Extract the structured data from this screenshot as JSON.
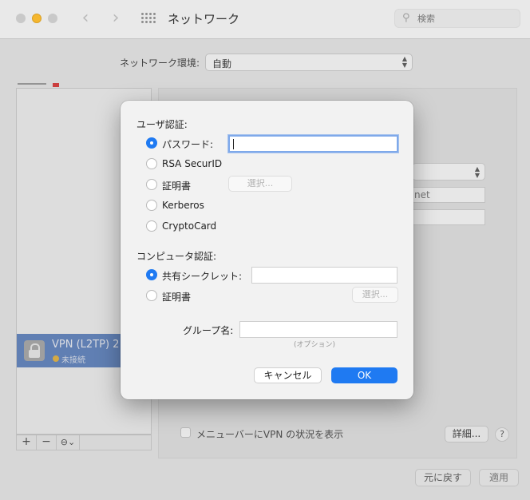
{
  "window": {
    "title": "ネットワーク",
    "search_placeholder": "検索",
    "icons": {
      "back": "chevron-left-icon",
      "forward": "chevron-right-icon",
      "grid": "grid-icon",
      "search": "search-icon"
    }
  },
  "location": {
    "label": "ネットワーク環境:",
    "value": "自動"
  },
  "sidebar": {
    "selected_service": {
      "name": "VPN (L2TP) 2",
      "status": "未接続"
    },
    "toolbar": {
      "add": "+",
      "remove": "−",
      "action": "⊖⌄"
    }
  },
  "detail": {
    "field_fragment": "net",
    "show_vpn_status_label": "メニューバーにVPN の状況を表示",
    "advanced_button": "詳細...",
    "help_button": "?"
  },
  "footer": {
    "revert_button": "元に戻す",
    "apply_button": "適用"
  },
  "dialog": {
    "user_auth_label": "ユーザ認証:",
    "user_auth_options": [
      {
        "label": "パスワード:",
        "selected": true
      },
      {
        "label": "RSA SecurID",
        "selected": false
      },
      {
        "label": "証明書",
        "selected": false
      },
      {
        "label": "Kerberos",
        "selected": false
      },
      {
        "label": "CryptoCard",
        "selected": false
      }
    ],
    "password_value": "",
    "select_button": "選択...",
    "computer_auth_label": "コンピュータ認証:",
    "computer_auth_options": [
      {
        "label": "共有シークレット:",
        "selected": true
      },
      {
        "label": "証明書",
        "selected": false
      }
    ],
    "shared_secret_value": "",
    "computer_select_button": "選択...",
    "group_label": "グループ名:",
    "group_value": "",
    "group_hint": "(オプション)",
    "cancel_button": "キャンセル",
    "ok_button": "OK"
  }
}
